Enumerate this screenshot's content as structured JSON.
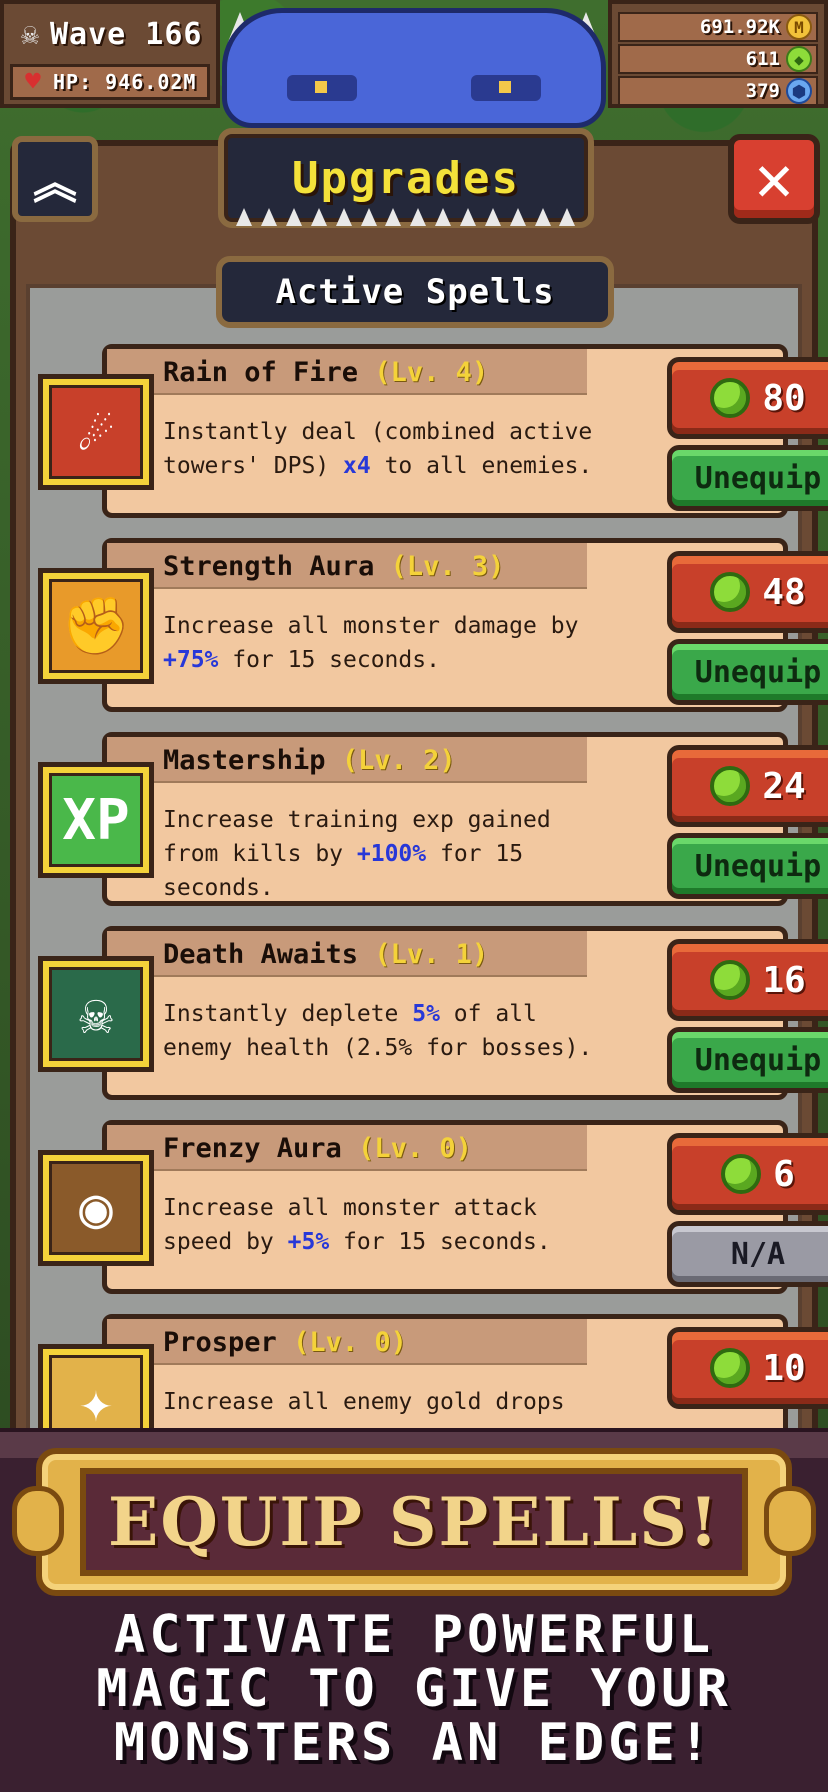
{
  "hud": {
    "wave": "Wave 166",
    "hp": "HP: 946.02M",
    "gold": "691.92K",
    "gems": "611",
    "shards": "379"
  },
  "header": {
    "title": "Upgrades",
    "section": "Active Spells"
  },
  "spells": [
    {
      "name": "Rain of Fire",
      "level": "(Lv. 4)",
      "desc_a": "Instantly deal (combined active towers' DPS) ",
      "desc_hl": "x4",
      "desc_b": " to all enemies.",
      "cost": "80",
      "action": "Unequip",
      "icon": "fire-rain-icon",
      "color": "#c8402a"
    },
    {
      "name": "Strength Aura",
      "level": "(Lv. 3)",
      "desc_a": "Increase all monster damage by ",
      "desc_hl": "+75%",
      "desc_b": " for 15 seconds.",
      "cost": "48",
      "action": "Unequip",
      "icon": "fist-icon",
      "color": "#e89a2a"
    },
    {
      "name": "Mastership",
      "level": "(Lv. 2)",
      "desc_a": "Increase training exp gained from kills by ",
      "desc_hl": "+100%",
      "desc_b": " for 15 seconds.",
      "cost": "24",
      "action": "Unequip",
      "icon": "xp-icon",
      "color": "#4ab84a"
    },
    {
      "name": "Death Awaits",
      "level": "(Lv. 1)",
      "desc_a": "Instantly deplete ",
      "desc_hl": "5%",
      "desc_b": " of all enemy health (2.5% for bosses).",
      "cost": "16",
      "action": "Unequip",
      "icon": "skull-icon",
      "color": "#2a6a4a"
    },
    {
      "name": "Frenzy Aura",
      "level": "(Lv. 0)",
      "desc_a": "Increase all monster attack speed by ",
      "desc_hl": "+5%",
      "desc_b": " for 15 seconds.",
      "cost": "6",
      "action": "N/A",
      "icon": "eye-icon",
      "color": "#8a5a2a"
    },
    {
      "name": "Prosper",
      "level": "(Lv. 0)",
      "desc_a": "Increase all enemy gold drops",
      "desc_hl": "",
      "desc_b": "",
      "cost": "10",
      "action": "",
      "icon": "gold-icon",
      "color": "#e2b24a"
    }
  ],
  "promo": {
    "plaque": "EQUIP SPELLS!",
    "line1": "ACTIVATE POWERFUL",
    "line2": "MAGIC TO GIVE YOUR",
    "line3": "MONSTERS AN EDGE!"
  }
}
